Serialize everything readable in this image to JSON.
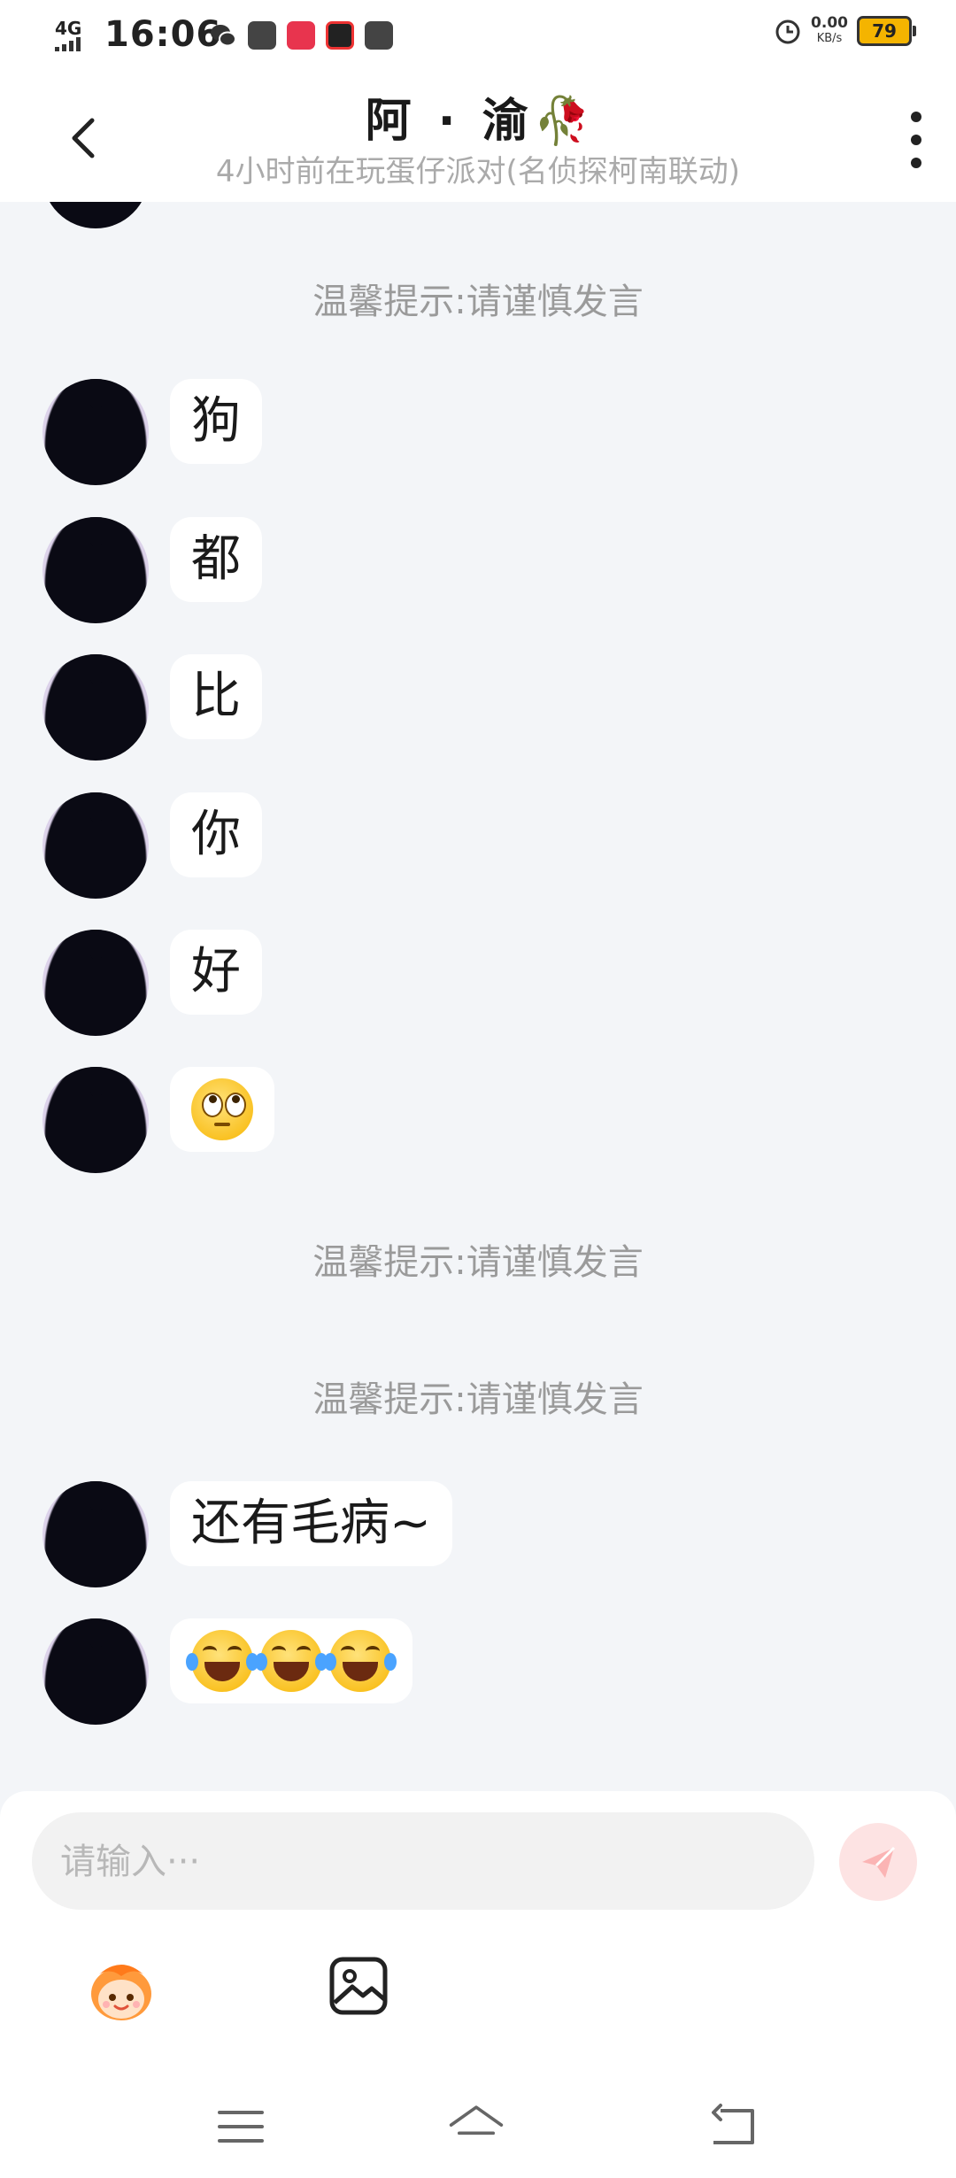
{
  "status_bar": {
    "network": "4G",
    "time": "16:06",
    "speed_value": "0.00",
    "speed_unit": "KB/s",
    "battery": "79"
  },
  "header": {
    "title": "阿 · 渝",
    "title_emoji": "🥀",
    "subtitle": "4小时前在玩蛋仔派对(名侦探柯南联动)"
  },
  "messages": {
    "notice_1": "温馨提示:请谨慎发言",
    "msg_1": "狗",
    "msg_2": "都",
    "msg_3": "比",
    "msg_4": "你",
    "msg_5": "好",
    "msg_6_emoji": "face-with-rolling-eyes",
    "notice_2": "温馨提示:请谨慎发言",
    "notice_3": "温馨提示:请谨慎发言",
    "msg_7": "还有毛病~",
    "msg_8_emoji": [
      "face-with-tears-of-joy",
      "face-with-tears-of-joy",
      "face-with-tears-of-joy"
    ]
  },
  "input": {
    "placeholder": "请输入···"
  },
  "colors": {
    "background": "#f3f5f8",
    "bubble": "#ffffff",
    "notice_text": "#9a9a9a",
    "send_button": "#fde3e3",
    "battery": "#f4b400"
  }
}
